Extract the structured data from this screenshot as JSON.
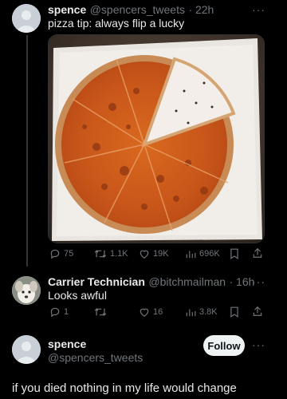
{
  "tweet1": {
    "name": "spence",
    "handle": "@spencers_tweets",
    "time": "· 22h",
    "text": "pizza tip: always flip a lucky",
    "actions": {
      "replies": "75",
      "retweets": "1.1K",
      "likes": "19K",
      "views": "696K"
    }
  },
  "reply": {
    "name": "Carrier Technician",
    "handle": "@bitchmailman",
    "time": "· 16h",
    "text": "Looks awful",
    "actions": {
      "replies": "1",
      "retweets": "",
      "likes": "16",
      "views": "3.8K"
    }
  },
  "profile": {
    "name": "spence",
    "handle": "@spencers_tweets",
    "follow_label": "Follow",
    "tweet_text": "if you died nothing in my life would change"
  },
  "more_label": "···",
  "colors": {
    "background": "#000000",
    "text": "#e7e9ea",
    "muted": "#71767b",
    "accent": "#1d9bf0"
  }
}
